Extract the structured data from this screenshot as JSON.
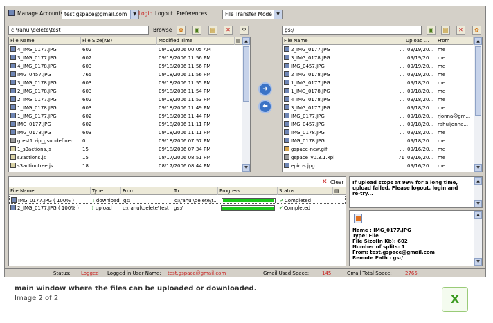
{
  "toolbar": {
    "manage_accounts": "Manage Accounts",
    "account": "test.gspace@gmail.com",
    "login": "Login",
    "logout": "Logout",
    "preferences": "Preferences",
    "mode": "File Transfer Mode"
  },
  "local": {
    "path": "c:\\rahul\\delete\\test",
    "browse": "Browse",
    "columns": [
      "File Name",
      "File Size(KB)",
      "Modified Time"
    ],
    "rows": [
      {
        "name": "4_IMG_0177.JPG",
        "size": "602",
        "time": "09/19/2006 00:05 AM",
        "type": "img"
      },
      {
        "name": "3_IMG_0177.JPG",
        "size": "602",
        "time": "09/18/2006 11:56 PM",
        "type": "img"
      },
      {
        "name": "4_IMG_0178.JPG",
        "size": "603",
        "time": "09/18/2006 11:56 PM",
        "type": "img"
      },
      {
        "name": "IMG_0457.JPG",
        "size": "765",
        "time": "09/18/2006 11:56 PM",
        "type": "img"
      },
      {
        "name": "3_IMG_0178.JPG",
        "size": "603",
        "time": "09/18/2006 11:55 PM",
        "type": "img"
      },
      {
        "name": "2_IMG_0178.JPG",
        "size": "603",
        "time": "09/18/2006 11:54 PM",
        "type": "img"
      },
      {
        "name": "2_IMG_0177.JPG",
        "size": "602",
        "time": "09/18/2006 11:53 PM",
        "type": "img"
      },
      {
        "name": "1_IMG_0178.JPG",
        "size": "603",
        "time": "09/18/2006 11:49 PM",
        "type": "img"
      },
      {
        "name": "1_IMG_0177.JPG",
        "size": "602",
        "time": "09/18/2006 11:44 PM",
        "type": "img"
      },
      {
        "name": "IMG_0177.JPG",
        "size": "602",
        "time": "09/18/2006 11:11 PM",
        "type": "img"
      },
      {
        "name": "IMG_0178.JPG",
        "size": "603",
        "time": "09/18/2006 11:11 PM",
        "type": "img"
      },
      {
        "name": "gtest1.zip_gsundefined",
        "size": "0",
        "time": "09/18/2006 07:57 PM",
        "type": "zip"
      },
      {
        "name": "1_s3actions.js",
        "size": "15",
        "time": "09/18/2006 07:34 PM",
        "type": "js"
      },
      {
        "name": "s3actions.js",
        "size": "15",
        "time": "08/17/2006 08:51 PM",
        "type": "js"
      },
      {
        "name": "s3actiontree.js",
        "size": "18",
        "time": "08/17/2006 08:44 PM",
        "type": "js"
      }
    ]
  },
  "remote": {
    "path": "gs:/",
    "columns": [
      "File Name",
      "Upload ...",
      "From"
    ],
    "rows": [
      {
        "name": "2_IMG_0177.JPG",
        "dots": "...",
        "upload": "09/19/20...",
        "from": "me",
        "type": "img"
      },
      {
        "name": "3_IMG_0178.JPG",
        "dots": "...",
        "upload": "09/19/20...",
        "from": "me",
        "type": "img"
      },
      {
        "name": "IMG_0457.JPG",
        "dots": "...",
        "upload": "09/19/20...",
        "from": "me",
        "type": "img"
      },
      {
        "name": "2_IMG_0178.JPG",
        "dots": "...",
        "upload": "09/19/20...",
        "from": "me",
        "type": "img"
      },
      {
        "name": "1_IMG_0177.JPG",
        "dots": "...",
        "upload": "09/18/20...",
        "from": "me",
        "type": "img"
      },
      {
        "name": "1_IMG_0178.JPG",
        "dots": "...",
        "upload": "09/18/20...",
        "from": "me",
        "type": "img"
      },
      {
        "name": "4_IMG_0178.JPG",
        "dots": "...",
        "upload": "09/18/20...",
        "from": "me",
        "type": "img"
      },
      {
        "name": "3_IMG_0177.JPG",
        "dots": "...",
        "upload": "09/18/20...",
        "from": "me",
        "type": "img"
      },
      {
        "name": "IMG_0177.JPG",
        "dots": "...",
        "upload": "09/18/20...",
        "from": "rjonna@gm...",
        "type": "img"
      },
      {
        "name": "IMG_0457.JPG",
        "dots": "...",
        "upload": "09/18/20...",
        "from": "rahuljonna...",
        "type": "img"
      },
      {
        "name": "IMG_0178.JPG",
        "dots": "...",
        "upload": "09/18/20...",
        "from": "me",
        "type": "img"
      },
      {
        "name": "IMG_0178.JPG",
        "dots": "...",
        "upload": "09/18/20...",
        "from": "me",
        "type": "img"
      },
      {
        "name": "gspace-new.gif",
        "dots": "...",
        "upload": "09/16/20...",
        "from": "me",
        "type": "gif"
      },
      {
        "name": "gspace_v0.3.1.xpi",
        "dots": "71",
        "upload": "09/16/20...",
        "from": "me",
        "type": "zip"
      },
      {
        "name": "epirus.jpg",
        "dots": "...",
        "upload": "09/16/20...",
        "from": "me",
        "type": "img"
      }
    ]
  },
  "transfer": {
    "clear": "Clear",
    "columns": [
      "File Name",
      "Type",
      "From",
      "To",
      "Progress",
      "Status"
    ],
    "rows": [
      {
        "name": "IMG_0177.JPG ( 100% )",
        "type": "download",
        "from": "gs:",
        "to": "c:\\rahul\\delete\\t...",
        "progress": 1.0,
        "status": "Completed"
      },
      {
        "name": "2_IMG_0177.JPG ( 100% )",
        "type": "upload",
        "from": "c:\\rahul\\delete\\test",
        "to": "gs:/",
        "progress": 1.0,
        "status": "Completed"
      }
    ]
  },
  "notice": {
    "line1": "If upload stops at 99% for a long time,",
    "line2": "upload failed. Please logout, login and",
    "line3": "re-try..."
  },
  "details": {
    "name": "Name : IMG_0177.JPG",
    "type": "Type: File",
    "size": "File Size(In Kb): 602",
    "splits": "Number of splits: 1",
    "from": "From: test.gspace@gmail.com",
    "remote": "Remote Path : gs:/"
  },
  "statusbar": {
    "status_label": "Status:",
    "status_value": "Logged",
    "user_label": "Logged in User Name:",
    "user_value": "test.gspace@gmail.com",
    "used_label": "Gmail Used Space:",
    "used_value": "145",
    "total_label": "Gmail Total Space:",
    "total_value": "2765"
  },
  "caption": {
    "title": "main window where the files can be uploaded or downloaded.",
    "subtitle": "Image 2 of 2",
    "close": "X"
  },
  "colors": {
    "accent_red": "#c8201e",
    "progress_green": "#19c719",
    "panel_bg": "#d4d0c8"
  }
}
